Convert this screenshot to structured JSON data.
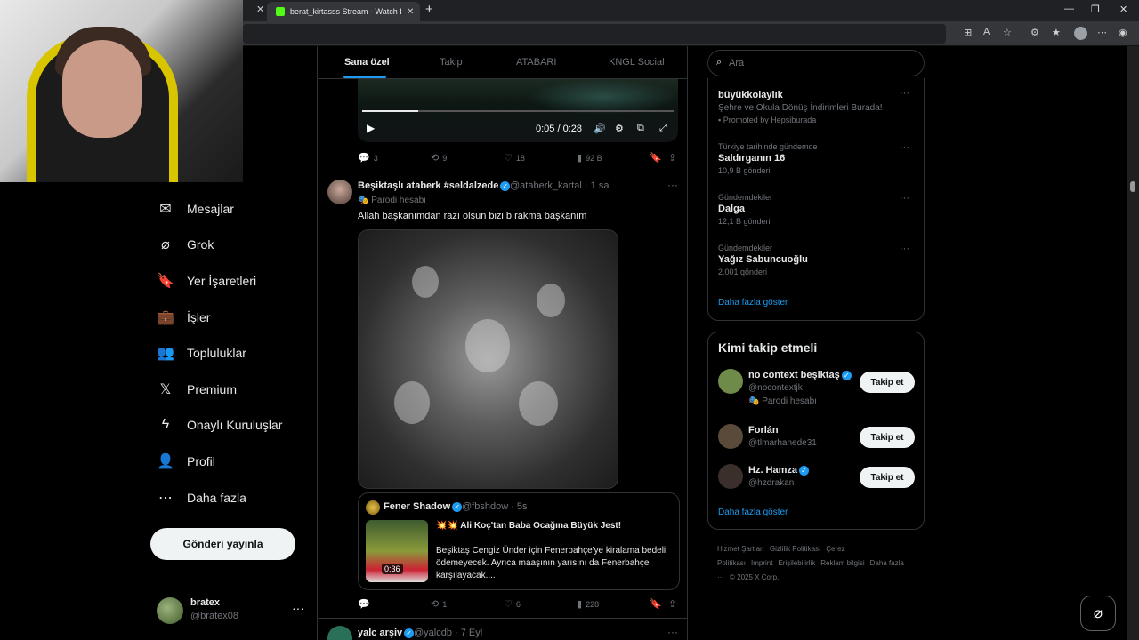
{
  "browser": {
    "tab_title": "berat_kirtasss Stream - Watch Live",
    "tab_close": "✕",
    "new_tab": "+",
    "min": "—",
    "max": "❐",
    "close": "✕"
  },
  "nav": {
    "items": [
      {
        "label": "Mesajlar",
        "icon": "✉"
      },
      {
        "label": "Grok",
        "icon": "⌀"
      },
      {
        "label": "Yer İşaretleri",
        "icon": "🔖"
      },
      {
        "label": "İşler",
        "icon": "💼"
      },
      {
        "label": "Topluluklar",
        "icon": "👥"
      },
      {
        "label": "Premium",
        "icon": "𝕏"
      },
      {
        "label": "Onaylı Kuruluşlar",
        "icon": "ϟ"
      },
      {
        "label": "Profil",
        "icon": "👤"
      },
      {
        "label": "Daha fazla",
        "icon": "⋯"
      }
    ],
    "post_button": "Gönderi yayınla",
    "me": {
      "name": "bratex",
      "handle": "@bratex08",
      "more": "···"
    }
  },
  "feed": {
    "tabs": [
      "Sana özel",
      "Takip",
      "ATABARI",
      "KNGL Social"
    ],
    "video1": {
      "time": "0:05 / 0:28",
      "progress": 0.18
    },
    "tweet1_stats": {
      "replies": "3",
      "reposts": "9",
      "likes": "18",
      "views": "92 B"
    },
    "tweet2": {
      "name": "Beşiktaşlı ataberk #seldalzede",
      "handle": "@ataberk_kartal · 1 sa",
      "parody": "Parodi hesabı",
      "text": "Allah başkanımdan razı olsun bizi bırakma başkanım",
      "quote": {
        "name": "Fener Shadow",
        "handle": "@fbshdow · 5s",
        "title": "💥💥 Ali Koç'tan Baba Ocağına Büyük Jest!",
        "body": "Beşiktaş Cengiz Ünder için Fenerbahçe'ye kiralama bedeli ödemeyecek. Ayrıca maaşının yarısını da Fenerbahçe karşılayacak....",
        "duration": "0:36"
      },
      "stats": {
        "replies": "",
        "reposts": "1",
        "likes": "6",
        "views": "228"
      }
    },
    "tweet3": {
      "name": "yalc arşiv",
      "handle": "@yalcdb · 7 Eyl"
    }
  },
  "sidebar": {
    "search_placeholder": "Ara",
    "ad": {
      "title": "büyükkolaylık",
      "sub": "Şehre ve Okula Dönüş İndirimleri Burada!",
      "promo": "Promoted by Hepsiburada"
    },
    "trends": [
      {
        "meta": "Türkiye tarihinde gündemde",
        "title": "Saldırganın 16",
        "count": "10,9 B gönderi"
      },
      {
        "meta": "Gündemdekiler",
        "title": "Dalga",
        "count": "12,1 B gönderi"
      },
      {
        "meta": "Gündemdekiler",
        "title": "Yağız Sabuncuoğlu",
        "count": "2.001 gönderi"
      }
    ],
    "show_more": "Daha fazla göster",
    "who_title": "Kimi takip etmeli",
    "who": [
      {
        "name": "no context beşiktaş",
        "handle": "@nocontextjk",
        "parody": "Parodi hesabı",
        "verified": true,
        "color": "#6f8b4a"
      },
      {
        "name": "Forlán",
        "handle": "@tlmarhanede31",
        "parody": "",
        "verified": false,
        "color": "#5a4a3a"
      },
      {
        "name": "Hz. Hamza",
        "handle": "@hzdrakan",
        "parody": "",
        "verified": true,
        "color": "#3a2f2a"
      }
    ],
    "follow_label": "Takip et",
    "who_show_more": "Daha fazla göster",
    "footer": [
      "Hizmet Şartları",
      "Gizlilik Politikası",
      "Çerez Politikası",
      "Imprint",
      "Erişilebilirlik",
      "Reklam bilgisi",
      "Daha fazla ···",
      "© 2025 X Corp."
    ]
  }
}
